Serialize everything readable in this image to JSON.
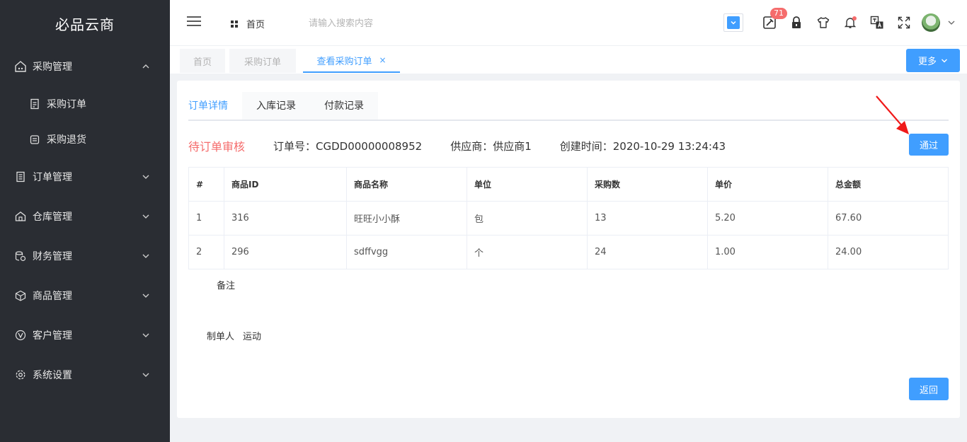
{
  "app": {
    "title": "必品云商"
  },
  "sidebar": {
    "items": [
      {
        "label": "采购管理",
        "icon": "cart-house-icon",
        "expanded": true,
        "children": [
          {
            "label": "采购订单",
            "icon": "document-icon"
          },
          {
            "label": "采购退货",
            "icon": "return-box-icon"
          }
        ]
      },
      {
        "label": "订单管理",
        "icon": "order-icon"
      },
      {
        "label": "仓库管理",
        "icon": "warehouse-icon"
      },
      {
        "label": "财务管理",
        "icon": "finance-icon"
      },
      {
        "label": "商品管理",
        "icon": "box-icon"
      },
      {
        "label": "客户管理",
        "icon": "customer-icon"
      },
      {
        "label": "系统设置",
        "icon": "gear-icon"
      }
    ]
  },
  "header": {
    "home_label": "首页",
    "search_placeholder": "请输入搜索内容",
    "badge_count": "71"
  },
  "tabs": [
    {
      "label": "首页",
      "active": false
    },
    {
      "label": "采购订单",
      "active": false
    },
    {
      "label": "查看采购订单",
      "active": true,
      "closable": true,
      "close_label": "×"
    }
  ],
  "more_label": "更多",
  "subtabs": [
    {
      "label": "订单详情",
      "active": true
    },
    {
      "label": "入库记录",
      "active": false
    },
    {
      "label": "付款记录",
      "active": false
    }
  ],
  "order": {
    "status": "待订单审核",
    "number": "订单号：CGDD00000008952",
    "supplier": "供应商：供应商1",
    "created": "创建时间：2020-10-29 13:24:43",
    "approve_label": "通过",
    "columns": [
      "#",
      "商品ID",
      "商品名称",
      "单位",
      "采购数",
      "单价",
      "总金额"
    ],
    "rows": [
      [
        "1",
        "316",
        "旺旺小小酥",
        "包",
        "13",
        "5.20",
        "67.60"
      ],
      [
        "2",
        "296",
        "sdffvgg",
        "个",
        "24",
        "1.00",
        "24.00"
      ]
    ],
    "remark_label": "备注",
    "maker_label": "制单人",
    "maker_value": "运动",
    "back_label": "返回"
  },
  "colors": {
    "accent": "#409eff",
    "danger": "#f56c6c",
    "sidebar_bg": "#2a2d33"
  }
}
